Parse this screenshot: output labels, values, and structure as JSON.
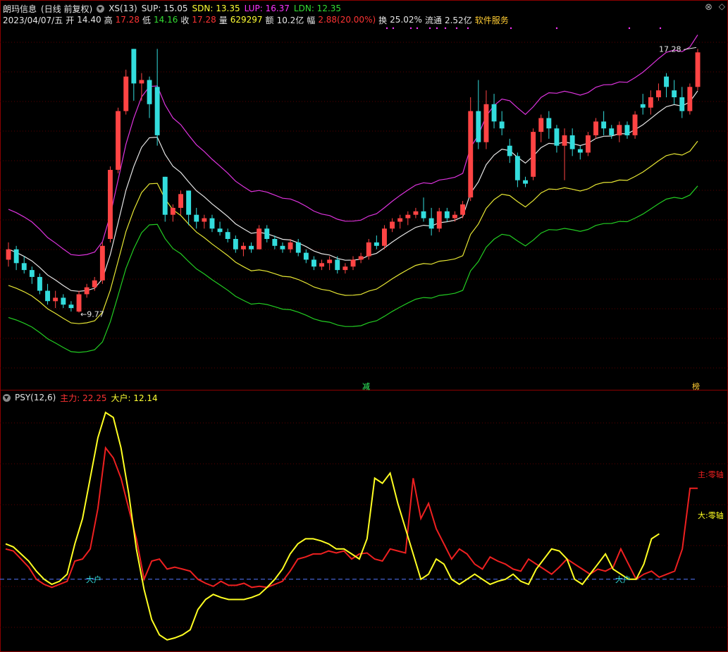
{
  "header": {
    "stock_name": "朗玛信息",
    "period": "(日线 前复权)",
    "indicator": "XS(13)",
    "sup_label": "SUP: 15.05",
    "sdn_label": "SDN: 13.35",
    "lup_label": "LUP: 16.37",
    "ldn_label": "LDN: 12.35"
  },
  "quote": {
    "date": "2023/04/07/五",
    "open_label": "开",
    "open": "14.40",
    "high_label": "高",
    "high": "17.28",
    "low_label": "低",
    "low": "14.16",
    "close_label": "收",
    "close": "17.28",
    "volume_label": "量",
    "volume": "629297",
    "amount_label": "额",
    "amount": "10.2亿",
    "change_label": "幅",
    "change": "2.88(20.00%)",
    "turnover_label": "换",
    "turnover": "25.02%",
    "float_label": "流通",
    "float": "2.52亿",
    "sector": "软件服务"
  },
  "annotations": {
    "max_price": "17.28",
    "min_price": "9.77",
    "tag_jian": "减",
    "tag_bang": "榜"
  },
  "sub": {
    "indicator": "PSY(12,6)",
    "main_label": "主力: 22.25",
    "big_label": "大户: 12.14",
    "dahu_text": "大户",
    "zhu_zero": "主:零轴",
    "da_zero": "大:零轴"
  },
  "colors": {
    "background": "#000000",
    "up": "#ff4444",
    "down": "#33dddd",
    "mid_line": "#e6e6e6",
    "upper_band": "#dd33dd",
    "lower_band_y": "#e6e633",
    "lower_band_g": "#22cc22",
    "main_line": "#ee2020",
    "big_line": "#ffff22",
    "ref_line": "#5577ff"
  },
  "chart_data": [
    {
      "type": "candlestick",
      "y_unit": "price",
      "candles": [
        [
          11.3,
          11.8,
          11.1,
          11.6
        ],
        [
          11.6,
          11.7,
          11.0,
          11.2
        ],
        [
          11.2,
          11.4,
          10.9,
          11.0
        ],
        [
          11.0,
          11.1,
          10.6,
          10.8
        ],
        [
          10.8,
          10.9,
          10.3,
          10.4
        ],
        [
          10.4,
          10.6,
          10.0,
          10.1
        ],
        [
          10.1,
          10.4,
          9.9,
          10.2
        ],
        [
          10.2,
          10.3,
          9.9,
          10.0
        ],
        [
          10.0,
          10.1,
          9.8,
          9.9
        ],
        [
          9.8,
          10.4,
          9.77,
          10.3
        ],
        [
          10.3,
          10.6,
          10.2,
          10.5
        ],
        [
          10.5,
          10.8,
          10.4,
          10.7
        ],
        [
          10.7,
          11.8,
          10.6,
          11.7
        ],
        [
          11.9,
          14.0,
          11.8,
          13.9
        ],
        [
          13.9,
          15.7,
          13.8,
          15.6
        ],
        [
          15.6,
          16.8,
          15.5,
          16.6
        ],
        [
          17.4,
          17.4,
          15.9,
          16.4
        ],
        [
          16.4,
          16.7,
          15.9,
          16.5
        ],
        [
          16.5,
          16.6,
          15.4,
          15.8
        ],
        [
          16.3,
          17.4,
          14.6,
          14.9
        ],
        [
          13.7,
          13.7,
          12.4,
          12.6
        ],
        [
          12.6,
          12.9,
          12.4,
          12.8
        ],
        [
          12.8,
          13.3,
          12.6,
          13.2
        ],
        [
          13.3,
          13.3,
          12.3,
          12.6
        ],
        [
          12.6,
          12.8,
          12.2,
          12.4
        ],
        [
          12.4,
          12.6,
          12.2,
          12.5
        ],
        [
          12.5,
          12.6,
          12.1,
          12.2
        ],
        [
          12.2,
          12.4,
          12.0,
          12.1
        ],
        [
          12.1,
          12.2,
          11.8,
          11.9
        ],
        [
          11.9,
          12.0,
          11.5,
          11.6
        ],
        [
          11.6,
          11.8,
          11.4,
          11.7
        ],
        [
          11.7,
          11.8,
          11.5,
          11.6
        ],
        [
          11.6,
          12.3,
          11.6,
          12.2
        ],
        [
          12.2,
          12.3,
          11.8,
          11.9
        ],
        [
          11.9,
          12.0,
          11.6,
          11.7
        ],
        [
          11.7,
          11.8,
          11.5,
          11.6
        ],
        [
          11.6,
          11.9,
          11.5,
          11.8
        ],
        [
          11.8,
          11.9,
          11.4,
          11.5
        ],
        [
          11.5,
          11.6,
          11.2,
          11.3
        ],
        [
          11.3,
          11.4,
          11.0,
          11.1
        ],
        [
          11.1,
          11.3,
          11.0,
          11.2
        ],
        [
          11.2,
          11.4,
          11.0,
          11.3
        ],
        [
          11.3,
          11.4,
          10.9,
          11.0
        ],
        [
          11.0,
          11.2,
          10.9,
          11.1
        ],
        [
          11.1,
          11.4,
          11.0,
          11.3
        ],
        [
          11.3,
          11.5,
          11.2,
          11.4
        ],
        [
          11.4,
          11.9,
          11.3,
          11.8
        ],
        [
          11.8,
          12.0,
          11.6,
          11.7
        ],
        [
          11.7,
          12.3,
          11.6,
          12.2
        ],
        [
          12.2,
          12.5,
          12.1,
          12.4
        ],
        [
          12.4,
          12.6,
          12.2,
          12.5
        ],
        [
          12.5,
          12.7,
          12.3,
          12.6
        ],
        [
          12.6,
          12.8,
          12.5,
          12.7
        ],
        [
          12.7,
          13.1,
          12.4,
          12.5
        ],
        [
          12.5,
          12.8,
          12.0,
          12.2
        ],
        [
          12.2,
          12.8,
          12.1,
          12.7
        ],
        [
          12.7,
          12.8,
          12.4,
          12.5
        ],
        [
          12.5,
          12.7,
          12.4,
          12.6
        ],
        [
          12.6,
          13.0,
          12.5,
          12.9
        ],
        [
          13.1,
          16.0,
          13.0,
          15.6
        ],
        [
          15.6,
          16.5,
          14.5,
          14.7
        ],
        [
          14.7,
          16.2,
          14.5,
          15.8
        ],
        [
          15.8,
          16.1,
          15.1,
          15.3
        ],
        [
          15.3,
          15.6,
          14.9,
          15.1
        ],
        [
          14.6,
          14.8,
          14.1,
          14.3
        ],
        [
          14.3,
          14.4,
          13.4,
          13.6
        ],
        [
          13.6,
          13.7,
          13.4,
          13.5
        ],
        [
          13.7,
          15.1,
          13.6,
          15.0
        ],
        [
          15.0,
          15.5,
          14.7,
          15.4
        ],
        [
          15.4,
          15.6,
          14.8,
          15.1
        ],
        [
          15.1,
          15.2,
          14.4,
          14.6
        ],
        [
          14.6,
          15.1,
          13.6,
          14.9
        ],
        [
          14.9,
          15.1,
          14.3,
          14.5
        ],
        [
          14.5,
          14.6,
          14.2,
          14.4
        ],
        [
          14.4,
          15.0,
          14.3,
          14.9
        ],
        [
          14.9,
          15.4,
          14.8,
          15.3
        ],
        [
          15.3,
          15.6,
          14.9,
          15.1
        ],
        [
          15.1,
          15.2,
          14.8,
          14.9
        ],
        [
          14.9,
          15.3,
          14.7,
          15.2
        ],
        [
          15.2,
          15.3,
          14.8,
          14.9
        ],
        [
          14.9,
          15.6,
          14.8,
          15.5
        ],
        [
          15.8,
          16.1,
          15.5,
          15.7
        ],
        [
          15.7,
          16.2,
          15.5,
          16.0
        ],
        [
          16.0,
          16.4,
          15.9,
          16.2
        ],
        [
          16.6,
          16.7,
          16.0,
          16.3
        ],
        [
          16.2,
          16.5,
          15.8,
          16.0
        ],
        [
          16.0,
          16.3,
          15.4,
          15.6
        ],
        [
          15.6,
          16.4,
          15.5,
          16.3
        ],
        [
          16.3,
          17.4,
          16.2,
          17.3
        ]
      ]
    },
    {
      "type": "line",
      "series": [
        {
          "name": "主力",
          "values": [
            40,
            38,
            30,
            22,
            10,
            5,
            2,
            5,
            8,
            28,
            30,
            40,
            80,
            140,
            130,
            110,
            80,
            50,
            10,
            28,
            30,
            20,
            22,
            20,
            18,
            10,
            6,
            3,
            8,
            4,
            4,
            6,
            2,
            3,
            2,
            5,
            8,
            18,
            30,
            32,
            35,
            35,
            38,
            36,
            38,
            30,
            35,
            36,
            30,
            28,
            40,
            38,
            36,
            110,
            70,
            85,
            60,
            45,
            30,
            40,
            35,
            25,
            20,
            32,
            28,
            25,
            20,
            18,
            30,
            25,
            20,
            15,
            22,
            30,
            25,
            20,
            15,
            20,
            18,
            22,
            40,
            25,
            10,
            15,
            18,
            12,
            15,
            18,
            40,
            100,
            100
          ]
        },
        {
          "name": "大户",
          "values": [
            45,
            42,
            35,
            28,
            18,
            10,
            5,
            8,
            15,
            45,
            70,
            110,
            150,
            175,
            170,
            140,
            95,
            40,
            0,
            -30,
            -45,
            -50,
            -48,
            -45,
            -40,
            -20,
            -10,
            -5,
            -8,
            -10,
            -10,
            -10,
            -8,
            -5,
            2,
            10,
            20,
            35,
            45,
            50,
            50,
            48,
            45,
            40,
            40,
            35,
            30,
            50,
            110,
            105,
            115,
            85,
            60,
            35,
            10,
            15,
            30,
            25,
            10,
            5,
            10,
            15,
            10,
            5,
            8,
            10,
            15,
            8,
            5,
            20,
            30,
            40,
            38,
            30,
            10,
            5,
            15,
            25,
            35,
            20,
            15,
            10,
            10,
            25,
            50,
            55
          ]
        }
      ]
    }
  ]
}
